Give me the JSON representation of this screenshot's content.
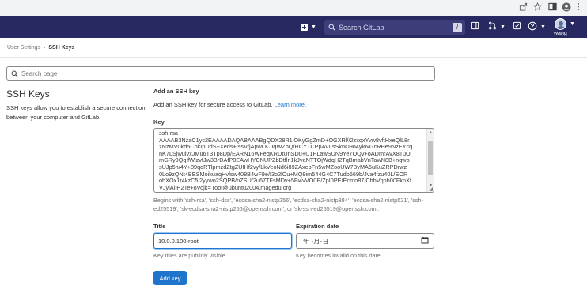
{
  "navbar": {
    "search_placeholder": "Search GitLab",
    "search_shortcut": "/",
    "username": "wang"
  },
  "breadcrumb": {
    "parent": "User Settings",
    "current": "SSH Keys"
  },
  "settings_search": {
    "placeholder": "Search page"
  },
  "section": {
    "title": "SSH Keys",
    "description": "SSH keys allow you to establish a secure connection between your computer and GitLab."
  },
  "form": {
    "heading": "Add an SSH key",
    "description": "Add an SSH key for secure access to GitLab.",
    "learn_more": "Learn more.",
    "key_label": "Key",
    "key_value": "ssh-rsa\nAAAAB3NzaC1yc2EAAAADAQABAAABgQDX28R1iOKyGgZmD+OGXRl//2zxqxYvw8vftHxeQlL8r\nzNzMV0kd5CokIpDdS+Xeds+IssV/jApwLKJIqWZoQ/RCYTCPpAVLsSknO9o4yiovGcRHe9NzEYcq\nnK7LSjwulvxJMu6T3Tp8Dp/EARN16WFeqKRDtUnSDu+U1PLawSUN9Ye7OQv+oADmrAvX8TuO\nmGRy9QqjfWlzvfJw3BrDAfP0EAwHYCNUPZbDtfln1kJvaNTTOjWdqH2TqBmabVnTawN8B+nqwo\nsUJp5h/4Y+89qdRTlpmzdZtgZUIHf2vy/LkVeoNd6i89ZAxepFn5wMZooUW7ByMA6uKuZRPDrwz\n0Lo9zQNt4BESMoikuaqHvfsw408B4wF9e/I3o2lOu+MQ9im544G4C7Tudo669b/Jva4fzu40L/EOR\nohXOx1r4kzC5i2yywo2SQPB/nZSU/2u67TFsMDv+5Fi4vVO0P/ZpI0PE/Ecmo87/ChhVqnh00FknXt\nVJylAiIH2Te+oVojk= root@ubuntu2004.magedu.org",
    "key_help": "Begins with 'ssh-rsa', 'ssh-dss', 'ecdsa-sha2-nistp256', 'ecdsa-sha2-nistp384', 'ecdsa-sha2-nistp521', 'ssh-ed25519', 'sk-ecdsa-sha2-nistp256@openssh.com', or 'sk-ssh-ed25519@openssh.com'.",
    "title_label": "Title",
    "title_value": "10.0.0.100-root",
    "title_hint": "Key titles are publicly visible.",
    "expiration_label": "Expiration date",
    "expiration_value": "年 -月-日",
    "expiration_hint": "Key becomes invalid on this date.",
    "submit_label": "Add key"
  },
  "colors": {
    "navbar": "#292961",
    "primary": "#1f75cb"
  },
  "icons": [
    "share-icon",
    "star-icon",
    "sidebar-icon",
    "profile-icon",
    "more-icon",
    "plus-icon",
    "search-icon",
    "merge-request-icon",
    "issues-icon",
    "todo-icon",
    "help-icon",
    "calendar-icon"
  ]
}
